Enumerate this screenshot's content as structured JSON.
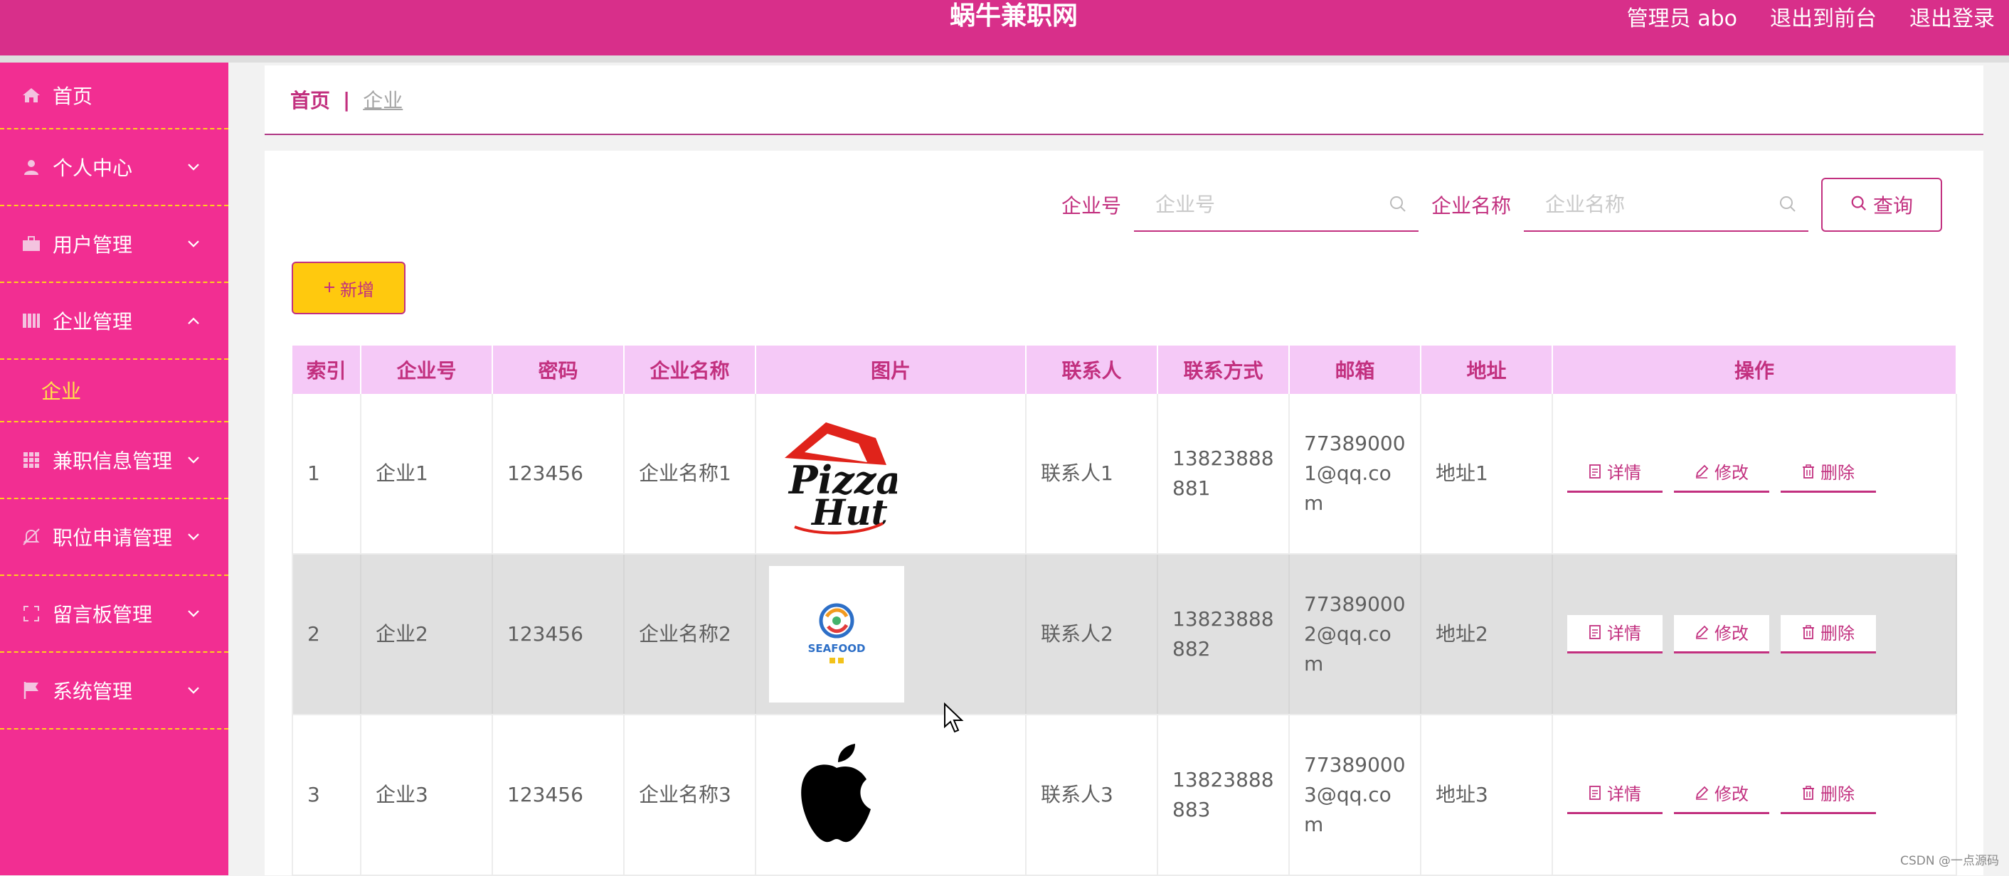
{
  "header": {
    "title": "蜗牛兼职网",
    "admin_label": "管理员 abo",
    "back_front": "退出到前台",
    "logout": "退出登录"
  },
  "sidebar": {
    "items": [
      {
        "label": "首页",
        "icon": "home-icon"
      },
      {
        "label": "个人中心",
        "icon": "user-icon",
        "expand": "collapsed"
      },
      {
        "label": "用户管理",
        "icon": "briefcase-icon",
        "expand": "collapsed"
      },
      {
        "label": "企业管理",
        "icon": "library-icon",
        "expand": "expanded"
      },
      {
        "label": "兼职信息管理",
        "icon": "grid-icon",
        "expand": "collapsed"
      },
      {
        "label": "职位申请管理",
        "icon": "bell-off-icon",
        "expand": "collapsed"
      },
      {
        "label": "留言板管理",
        "icon": "fullscreen-icon",
        "expand": "collapsed"
      },
      {
        "label": "系统管理",
        "icon": "flag-icon",
        "expand": "collapsed"
      }
    ],
    "submenu": "企业"
  },
  "breadcrumb": {
    "home": "首页",
    "sep": "|",
    "current": "企业"
  },
  "search": {
    "field1_label": "企业号",
    "field1_placeholder": "企业号",
    "field2_label": "企业名称",
    "field2_placeholder": "企业名称",
    "query_label": "查询"
  },
  "add_label": "新增",
  "table": {
    "columns": [
      "索引",
      "企业号",
      "密码",
      "企业名称",
      "图片",
      "联系人",
      "联系方式",
      "邮箱",
      "地址",
      "操作"
    ],
    "rows": [
      {
        "index": "1",
        "code": "企业1",
        "password": "123456",
        "name": "企业名称1",
        "image": "pizza-hut-logo",
        "contact": "联系人1",
        "phone": "13823888881",
        "email": "773890001@qq.com",
        "address": "地址1"
      },
      {
        "index": "2",
        "code": "企业2",
        "password": "123456",
        "name": "企业名称2",
        "image": "seafood-logo",
        "image_text": "SEAFOOD",
        "contact": "联系人2",
        "phone": "13823888882",
        "email": "773890002@qq.com",
        "address": "地址2"
      },
      {
        "index": "3",
        "code": "企业3",
        "password": "123456",
        "name": "企业名称3",
        "image": "apple-logo",
        "contact": "联系人3",
        "phone": "13823888883",
        "email": "773890003@qq.com",
        "address": "地址3"
      }
    ],
    "actions": {
      "detail": "详情",
      "edit": "修改",
      "delete": "删除"
    }
  },
  "logo_text": {
    "pizza": "Pizza",
    "hut": "Hut"
  },
  "watermark": "CSDN @一点源码",
  "colors": {
    "header": "#d82f8a",
    "sidebar": "#f22e92",
    "accent": "#c2307f",
    "add_button": "#ffc90e",
    "table_header": "#f5c9f7"
  }
}
